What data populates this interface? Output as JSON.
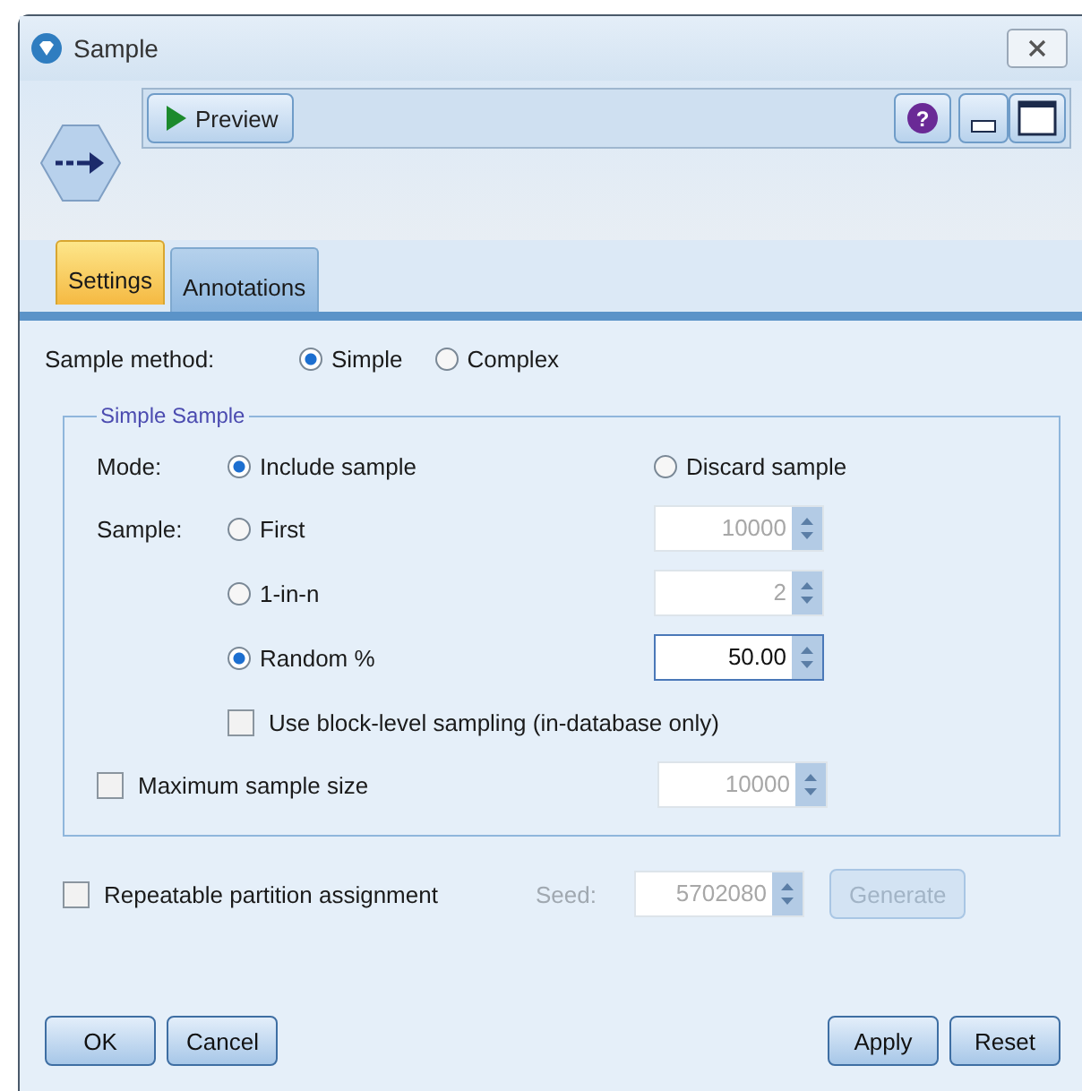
{
  "window": {
    "title": "Sample"
  },
  "toolbar": {
    "preview": "Preview",
    "help": "?"
  },
  "tabs": [
    {
      "label": "Settings",
      "selected": true
    },
    {
      "label": "Annotations",
      "selected": false
    }
  ],
  "sample_method": {
    "label": "Sample method:",
    "options": [
      {
        "label": "Simple",
        "selected": true
      },
      {
        "label": "Complex",
        "selected": false
      }
    ]
  },
  "group": {
    "title": "Simple Sample",
    "mode": {
      "label": "Mode:",
      "options": [
        {
          "label": "Include sample",
          "selected": true
        },
        {
          "label": "Discard sample",
          "selected": false
        }
      ]
    },
    "sample": {
      "label": "Sample:",
      "options": [
        {
          "label": "First",
          "selected": false,
          "value": "10000",
          "disabled": true
        },
        {
          "label": "1-in-n",
          "selected": false,
          "value": "2",
          "disabled": true
        },
        {
          "label": "Random %",
          "selected": true,
          "value": "50.00",
          "disabled": false
        }
      ]
    },
    "block_level": {
      "label": "Use block-level sampling (in-database only)",
      "checked": false
    },
    "max_size": {
      "label": "Maximum sample size",
      "checked": false,
      "value": "10000",
      "disabled": true
    }
  },
  "partition": {
    "label": "Repeatable partition assignment",
    "checked": false,
    "seed_label": "Seed:",
    "seed": "5702080",
    "disabled": true,
    "generate": "Generate"
  },
  "buttons_left": [
    "OK",
    "Cancel"
  ],
  "buttons_right": [
    "Apply",
    "Reset"
  ]
}
